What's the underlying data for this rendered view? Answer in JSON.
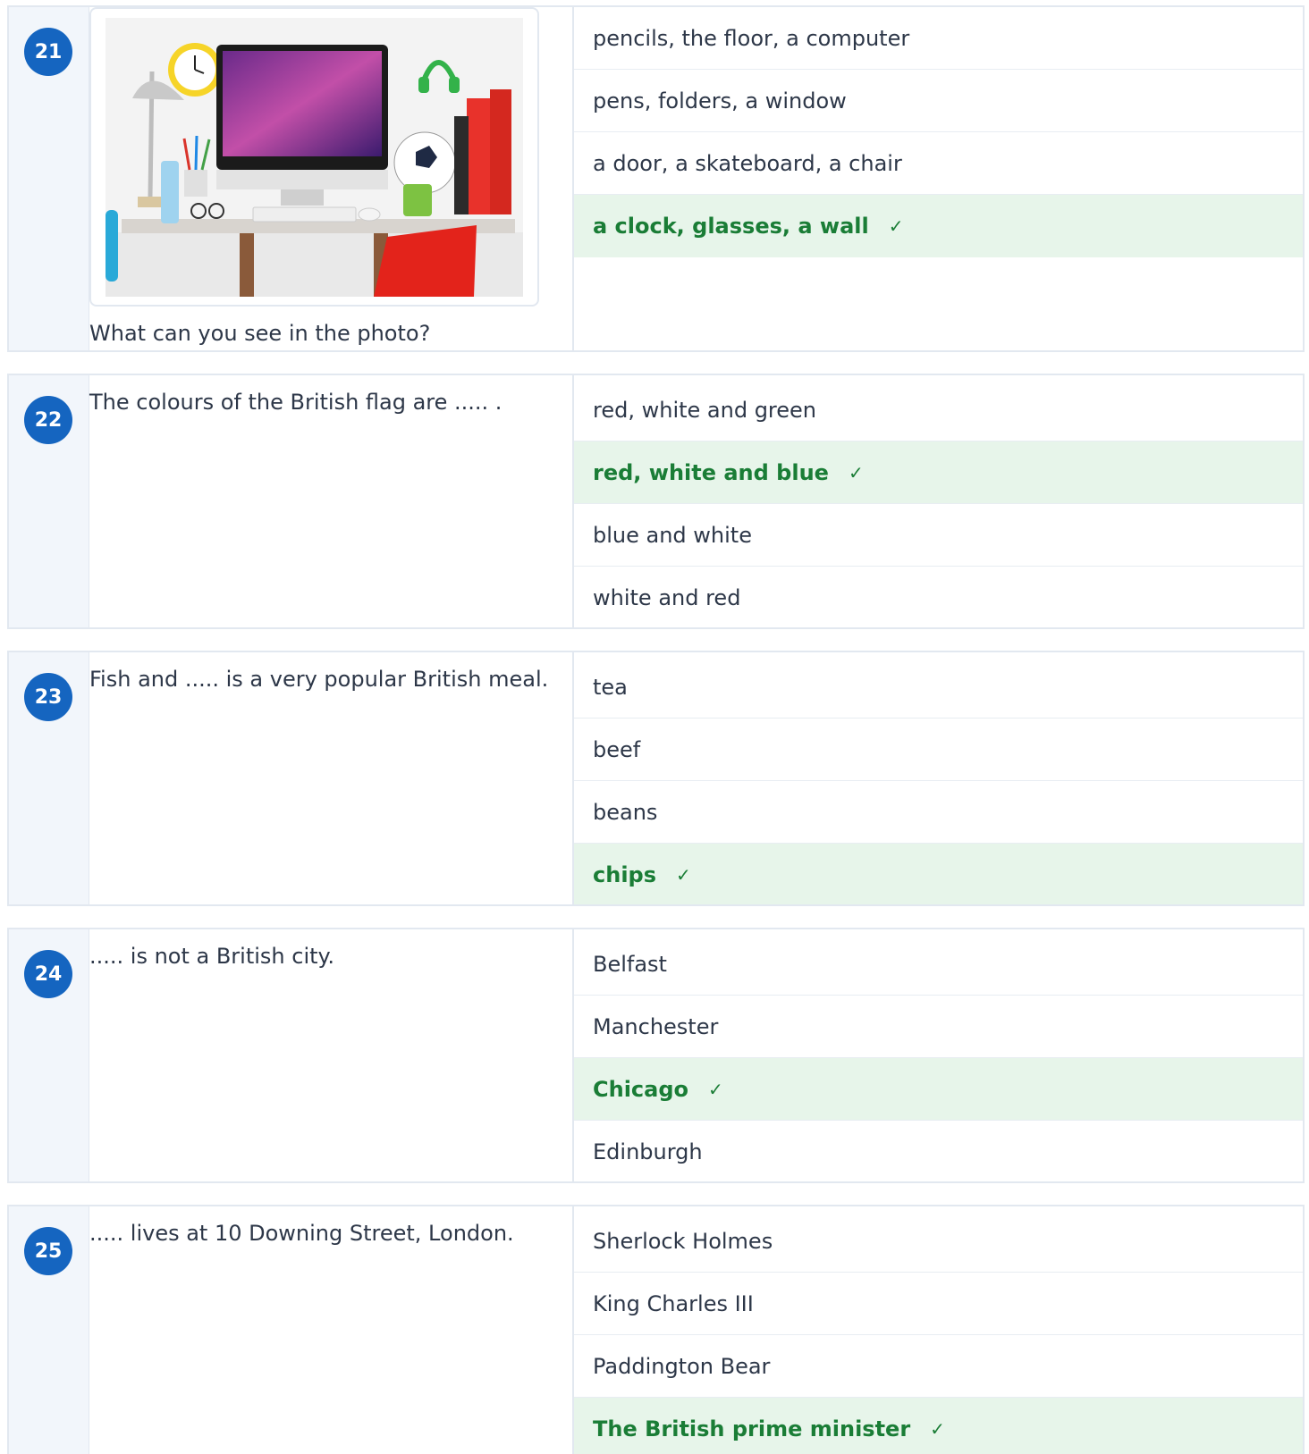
{
  "questions": [
    {
      "number": "21",
      "text": "What can you see in the photo?",
      "has_image": true,
      "options": [
        {
          "text": "pencils, the floor, a computer",
          "correct": false
        },
        {
          "text": "pens, folders, a window",
          "correct": false
        },
        {
          "text": "a door, a skateboard, a chair",
          "correct": false
        },
        {
          "text": "a clock, glasses, a wall",
          "correct": true
        }
      ]
    },
    {
      "number": "22",
      "text": "The colours of the British flag are ..... .",
      "options": [
        {
          "text": "red, white and green",
          "correct": false
        },
        {
          "text": "red, white and blue",
          "correct": true
        },
        {
          "text": "blue and white",
          "correct": false
        },
        {
          "text": "white and red",
          "correct": false
        }
      ]
    },
    {
      "number": "23",
      "text": "Fish and ..... is a very popular British meal.",
      "options": [
        {
          "text": "tea",
          "correct": false
        },
        {
          "text": "beef",
          "correct": false
        },
        {
          "text": "beans",
          "correct": false
        },
        {
          "text": "chips",
          "correct": true
        }
      ]
    },
    {
      "number": "24",
      "text": "..... is not a British city.",
      "options": [
        {
          "text": "Belfast",
          "correct": false
        },
        {
          "text": "Manchester",
          "correct": false
        },
        {
          "text": "Chicago",
          "correct": true
        },
        {
          "text": "Edinburgh",
          "correct": false
        }
      ]
    },
    {
      "number": "25",
      "text": "..... lives at 10 Downing Street, London.",
      "options": [
        {
          "text": "Sherlock Holmes",
          "correct": false
        },
        {
          "text": "King Charles III",
          "correct": false
        },
        {
          "text": "Paddington Bear",
          "correct": false
        },
        {
          "text": "The British prime minister",
          "correct": true
        }
      ]
    }
  ],
  "check_glyph": "✓",
  "colors": {
    "badge": "#1565c0",
    "correct_bg": "#e7f5ea",
    "correct_text": "#1a7d36",
    "number_column_bg": "#f2f6fb"
  }
}
